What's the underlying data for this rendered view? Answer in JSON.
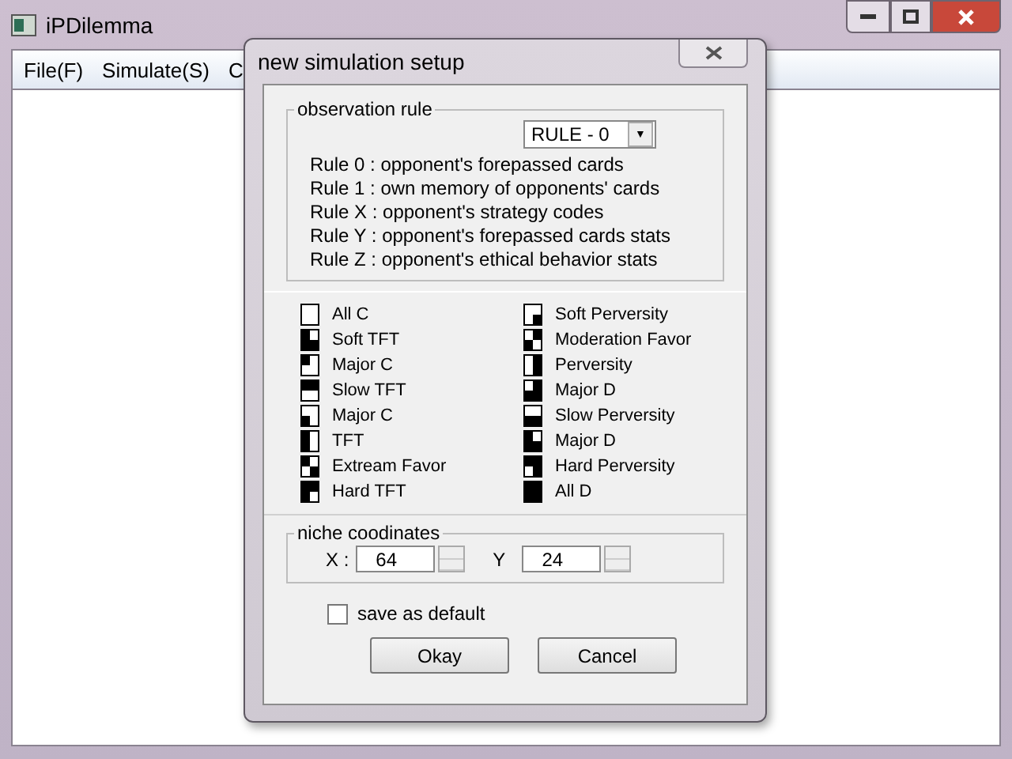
{
  "window": {
    "title": "iPDilemma",
    "menu": [
      "File(F)",
      "Simulate(S)",
      "C"
    ]
  },
  "dialog": {
    "title": "new simulation setup",
    "observation_rule": {
      "label": "observation rule",
      "dropdown": "RULE - 0",
      "dropdown_arrow": "▼",
      "rules": [
        "Rule 0 : opponent's forepassed cards",
        "Rule 1 : own memory of opponents' cards",
        "Rule X : opponent's strategy codes",
        "Rule Y : opponent's forepassed cards stats",
        "Rule Z : opponent's ethical behavior stats"
      ]
    },
    "strategies": [
      {
        "name": "All C",
        "cells": [
          false,
          false,
          false,
          false
        ]
      },
      {
        "name": "Soft TFT",
        "cells": [
          true,
          false,
          true,
          true
        ]
      },
      {
        "name": "Major C",
        "cells": [
          true,
          false,
          false,
          false
        ]
      },
      {
        "name": "Slow TFT",
        "cells": [
          true,
          true,
          false,
          false
        ]
      },
      {
        "name": "Major C",
        "cells": [
          false,
          false,
          true,
          false
        ]
      },
      {
        "name": "TFT",
        "cells": [
          true,
          false,
          true,
          false
        ]
      },
      {
        "name": "Extream Favor",
        "cells": [
          true,
          false,
          false,
          true
        ]
      },
      {
        "name": "Hard TFT",
        "cells": [
          true,
          true,
          true,
          false
        ]
      },
      {
        "name": "Soft Perversity",
        "cells": [
          false,
          false,
          false,
          true
        ]
      },
      {
        "name": "Moderation Favor",
        "cells": [
          false,
          true,
          true,
          false
        ]
      },
      {
        "name": "Perversity",
        "cells": [
          false,
          true,
          false,
          true
        ]
      },
      {
        "name": "Major D",
        "cells": [
          false,
          true,
          true,
          true
        ]
      },
      {
        "name": "Slow Perversity",
        "cells": [
          false,
          false,
          true,
          true
        ]
      },
      {
        "name": "Major D",
        "cells": [
          true,
          false,
          true,
          true
        ]
      },
      {
        "name": "Hard Perversity",
        "cells": [
          true,
          true,
          false,
          true
        ]
      },
      {
        "name": "All D",
        "cells": [
          true,
          true,
          true,
          true
        ]
      }
    ],
    "niche": {
      "label": "niche coodinates",
      "x_label": "X :",
      "x_value": "64",
      "y_label": "Y",
      "y_value": "24"
    },
    "save_default": {
      "label": "save as default",
      "checked": false
    },
    "buttons": [
      "Okay",
      "Cancel"
    ]
  }
}
